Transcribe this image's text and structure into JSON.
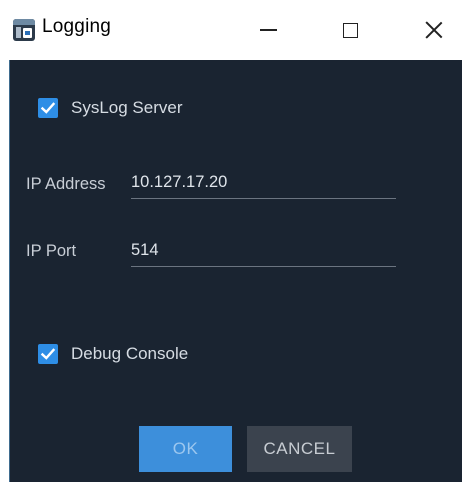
{
  "window": {
    "title": "Logging",
    "controls": {
      "minimize": "minimize-icon",
      "maximize": "maximize-icon",
      "close": "close-icon"
    }
  },
  "syslog": {
    "label": "SysLog Server",
    "checked": true
  },
  "ip_address": {
    "label": "IP Address",
    "value": "10.127.17.20"
  },
  "ip_port": {
    "label": "IP Port",
    "value": "514"
  },
  "debug_console": {
    "label": "Debug Console",
    "checked": true
  },
  "buttons": {
    "ok": "OK",
    "cancel": "CANCEL"
  },
  "colors": {
    "dialog_background": "#1a2431",
    "accent": "#2e8ee6",
    "ok_button": "#3d8fdb",
    "cancel_button": "#3b434e"
  }
}
